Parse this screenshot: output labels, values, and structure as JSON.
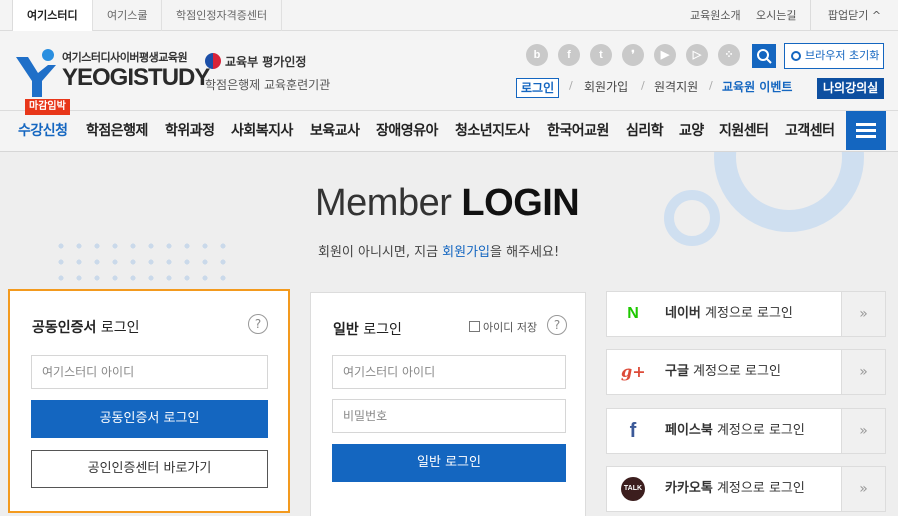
{
  "topbar": {
    "tabs": [
      "여기스터디",
      "여기스쿨",
      "학점인정자격증센터"
    ],
    "links": [
      "교육원소개",
      "오시는길"
    ],
    "popup_close": "팝업닫기 ^"
  },
  "header": {
    "logo_top": "여기스터디사이버평생교육원",
    "logo_main": "YEOGISTUDY",
    "moe_text": "교육부 평가인정",
    "moe_sub": "학점은행제 교육훈련기관",
    "sns_icons": [
      {
        "name": "blog-icon",
        "glyph": "b"
      },
      {
        "name": "facebook-icon",
        "glyph": "f"
      },
      {
        "name": "twitter-icon",
        "glyph": "t"
      },
      {
        "name": "kakaostory-icon",
        "glyph": "❜"
      },
      {
        "name": "youtube-icon",
        "glyph": "▶"
      },
      {
        "name": "play-icon",
        "glyph": "▷"
      },
      {
        "name": "other-sns-icon",
        "glyph": "⁘"
      }
    ],
    "browser_reset": "브라우저 초기화",
    "login": "로그인",
    "signup": "회원가입",
    "remote_support": "원격지원",
    "event": "교육원 이벤트",
    "my_lecture": "나의강의실"
  },
  "nav": {
    "badge": "마감임박",
    "items": [
      "수강신청",
      "학점은행제",
      "학위과정",
      "사회복지사",
      "보육교사",
      "장애영유아",
      "청소년지도사",
      "한국어교원",
      "심리학",
      "교양",
      "지원센터",
      "고객센터"
    ]
  },
  "login": {
    "title_light": "Member ",
    "title_bold": "LOGIN",
    "subtitle_pre": "회원이 아니시면, 지금 ",
    "subtitle_link": "회원가입",
    "subtitle_post": "을 해주세요!",
    "cert": {
      "title_bold": "공동인증서",
      "title_rest": " 로그인",
      "id_placeholder": "여기스터디 아이디",
      "login_button": "공동인증서 로그인",
      "center_button": "공인인증센터 바로가기"
    },
    "general": {
      "title_bold": "일반",
      "title_rest": " 로그인",
      "save_id": "아이디 저장",
      "id_placeholder": "여기스터디 아이디",
      "pw_placeholder": "비밀번호",
      "login_button": "일반 로그인"
    },
    "social": [
      {
        "name": "naver",
        "bold": "네이버",
        "rest": " 계정으로 로그인",
        "glyph": "N",
        "color": "#1ec800"
      },
      {
        "name": "google",
        "bold": "구글",
        "rest": " 계정으로 로그인",
        "glyph": "g+",
        "color": "#dd4b39"
      },
      {
        "name": "facebook",
        "bold": "페이스북",
        "rest": " 계정으로 로그인",
        "glyph": "f",
        "color": "#3b5998"
      },
      {
        "name": "kakao",
        "bold": "카카오톡",
        "rest": " 계정으로 로그인",
        "glyph": "TALK",
        "color": "#3c1e1e"
      }
    ],
    "help_glyph": "?",
    "arrow_glyph": "»"
  }
}
